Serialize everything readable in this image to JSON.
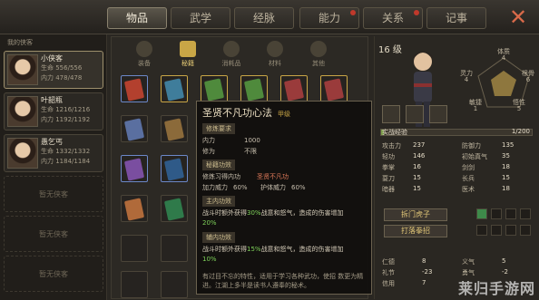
{
  "tabs": [
    {
      "label": "物品",
      "active": true
    },
    {
      "label": "武学",
      "active": false
    },
    {
      "label": "经脉",
      "active": false
    },
    {
      "label": "能力",
      "active": false,
      "dot": true
    },
    {
      "label": "关系",
      "active": false,
      "dot": true
    },
    {
      "label": "记事",
      "active": false
    }
  ],
  "close_icon": "✕",
  "party": {
    "title": "我的侠客",
    "members": [
      {
        "name": "小侠客",
        "hp": "生命 556/556",
        "mp": "内力 478/478",
        "active": true
      },
      {
        "name": "叶韶瓶",
        "hp": "生命 1216/1216",
        "mp": "内力 1192/1192",
        "active": false
      },
      {
        "name": "愚乞丐",
        "hp": "生命 1332/1332",
        "mp": "内力 1184/1184",
        "active": false
      }
    ],
    "empty_label": "暂无侠客"
  },
  "subtabs": [
    {
      "label": "装备",
      "active": false
    },
    {
      "label": "秘籍",
      "active": true
    },
    {
      "label": "消耗品",
      "active": false
    },
    {
      "label": "材料",
      "active": false
    },
    {
      "label": "其他",
      "active": false
    }
  ],
  "tooltip": {
    "title": "圣贤不凡功心法",
    "rank": "甲级",
    "sec1": "修炼要求",
    "req_neili_label": "内力",
    "req_neili_value": "1000",
    "req_limit_label": "修为",
    "req_limit_value": "不限",
    "sec2": "秘籍功效",
    "learn_label": "修炼习得内功",
    "learn_value": "圣贤不凡功",
    "power_label": "加力威力",
    "power_value": "60%",
    "defense_label": "护体威力",
    "defense_value": "60%",
    "sec3": "主内功效",
    "desc1": "战斗时额外获得",
    "desc1_hl": "30%",
    "desc1_rest": "战意和怒气，造成的伤害增加",
    "desc1_end": "20%",
    "sec4": "辅内功效",
    "desc2": "战斗时额外获得",
    "desc2_hl": "15%",
    "desc2_rest": "战意和怒气，造成的伤害增加",
    "desc2_end": "10%",
    "foot": "有过目不忘的特性，适用于学习各种武功，使招 数更为精进。江湖上多半是读书人遵奉的秘术。"
  },
  "character": {
    "level": "16 级",
    "radar_labels": [
      "体质",
      "灵力",
      "敏捷",
      "根骨",
      "悟性"
    ],
    "radar_values": [
      "4",
      "4",
      "1",
      "6",
      "5"
    ],
    "exp_label": "实战经验",
    "exp_value": "1/200",
    "exp_fraction": 0.005,
    "stats_left": [
      {
        "label": "攻击力",
        "value": "237"
      },
      {
        "label": "轻功",
        "value": "146"
      },
      {
        "label": "拳掌",
        "value": "16"
      },
      {
        "label": "耍刀",
        "value": "15"
      },
      {
        "label": "暗器",
        "value": "15"
      }
    ],
    "stats_right": [
      {
        "label": "防御力",
        "value": "135"
      },
      {
        "label": "初始真气",
        "value": "35"
      },
      {
        "label": "剑剑",
        "value": "18"
      },
      {
        "label": "长兵",
        "value": "15"
      },
      {
        "label": "医术",
        "value": "18"
      }
    ],
    "skill_buttons": [
      "拆门虎子",
      "打落拳招"
    ],
    "traits": [
      {
        "label": "仁德",
        "value": "8"
      },
      {
        "label": "礼节",
        "value": "-23"
      },
      {
        "label": "信用",
        "value": "7"
      },
      {
        "label": "义气",
        "value": "5"
      },
      {
        "label": "勇气",
        "value": "-2"
      }
    ]
  },
  "watermark": "莱归手游网"
}
